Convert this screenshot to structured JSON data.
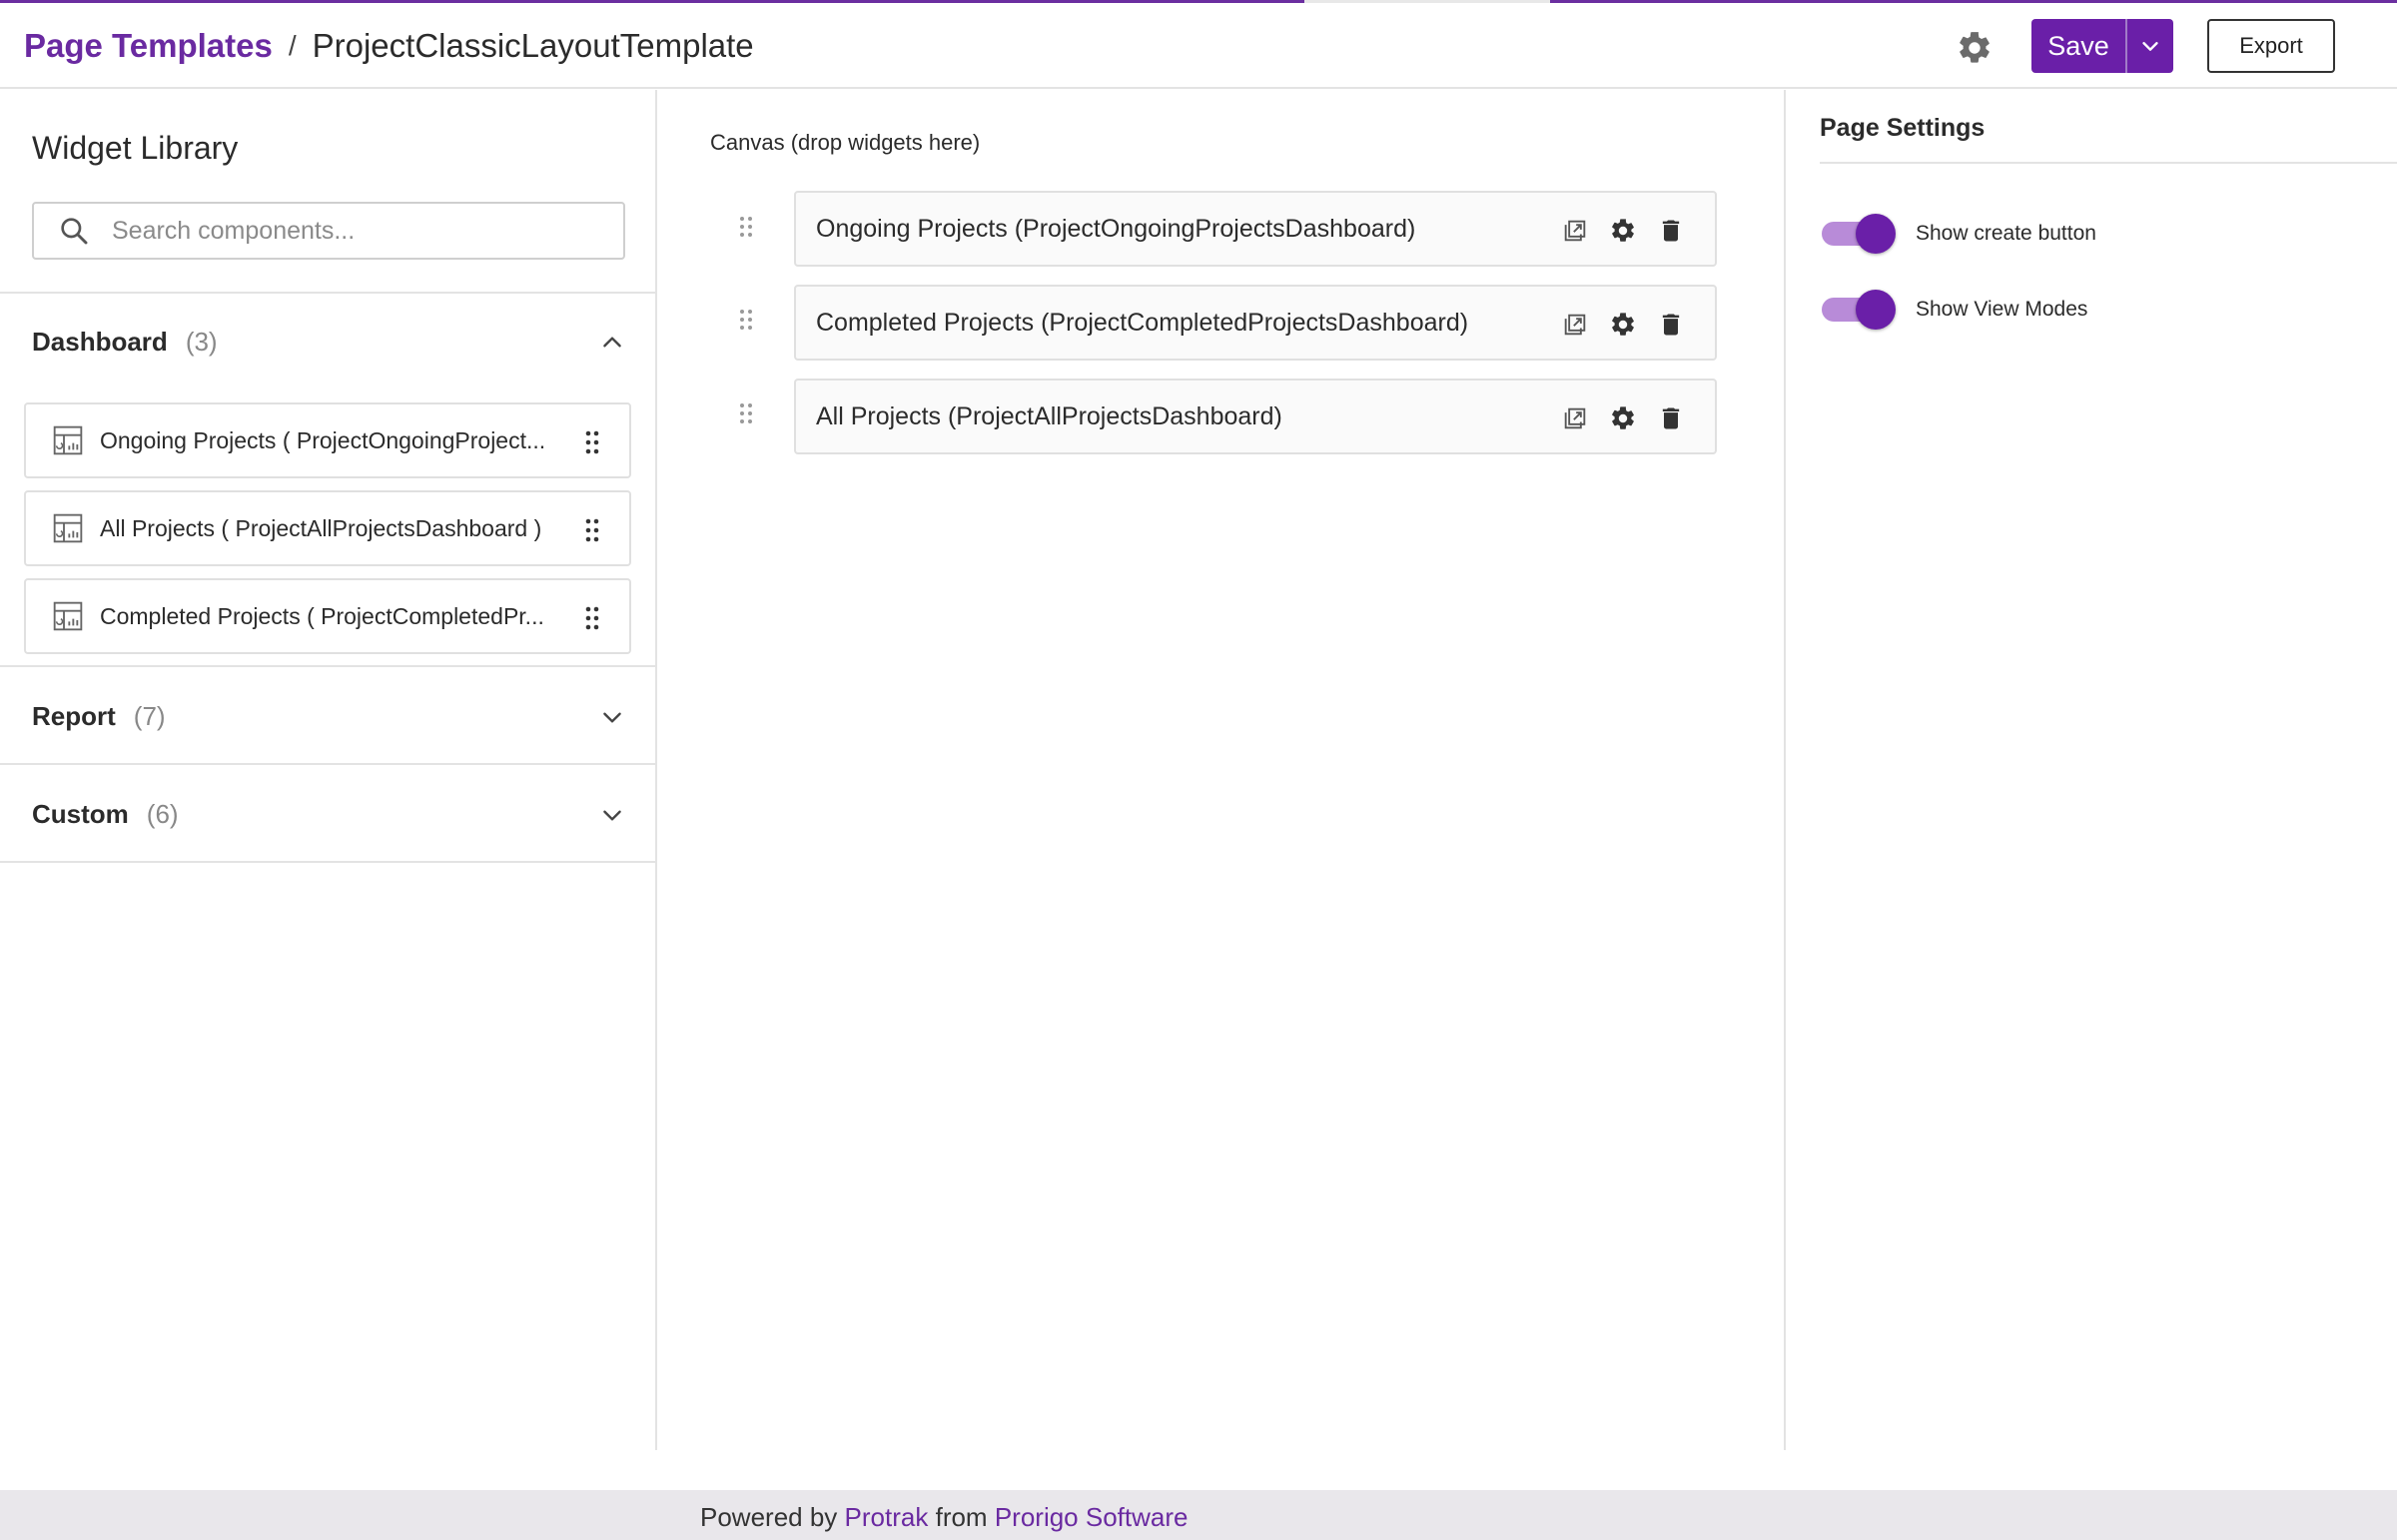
{
  "header": {
    "breadcrumb_root": "Page Templates",
    "breadcrumb_separator": "/",
    "breadcrumb_current": "ProjectClassicLayoutTemplate",
    "save_label": "Save",
    "export_label": "Export"
  },
  "sidebar": {
    "title": "Widget Library",
    "search_placeholder": "Search components...",
    "sections": [
      {
        "name": "Dashboard",
        "count": "(3)",
        "expanded": true,
        "items": [
          {
            "label": "Ongoing Projects ( ProjectOngoingProject..."
          },
          {
            "label": "All Projects ( ProjectAllProjectsDashboard )"
          },
          {
            "label": "Completed Projects ( ProjectCompletedPr..."
          }
        ]
      },
      {
        "name": "Report",
        "count": "(7)",
        "expanded": false
      },
      {
        "name": "Custom",
        "count": "(6)",
        "expanded": false
      }
    ]
  },
  "canvas": {
    "title": "Canvas (drop widgets here)",
    "widgets": [
      {
        "label": "Ongoing Projects (ProjectOngoingProjectsDashboard)"
      },
      {
        "label": "Completed Projects (ProjectCompletedProjectsDashboard)"
      },
      {
        "label": "All Projects (ProjectAllProjectsDashboard)"
      }
    ]
  },
  "page_settings": {
    "title": "Page Settings",
    "toggles": [
      {
        "label": "Show create button",
        "on": true
      },
      {
        "label": "Show View Modes",
        "on": true
      }
    ]
  },
  "footer": {
    "prefix": "Powered by",
    "product": "Protrak",
    "middle": "from",
    "company": "Prorigo Software"
  },
  "colors": {
    "brand": "#6a1fa8",
    "toggle_track": "#b88bd8",
    "footer_bg": "#e9e7eb"
  },
  "icons": {
    "settings": "gear-icon",
    "save_menu": "chevron-down-icon",
    "search": "search-icon",
    "widget": "dashboard-widget-icon",
    "drag": "drag-handle-icon",
    "open": "open-in-new-icon",
    "delete": "trash-icon"
  }
}
